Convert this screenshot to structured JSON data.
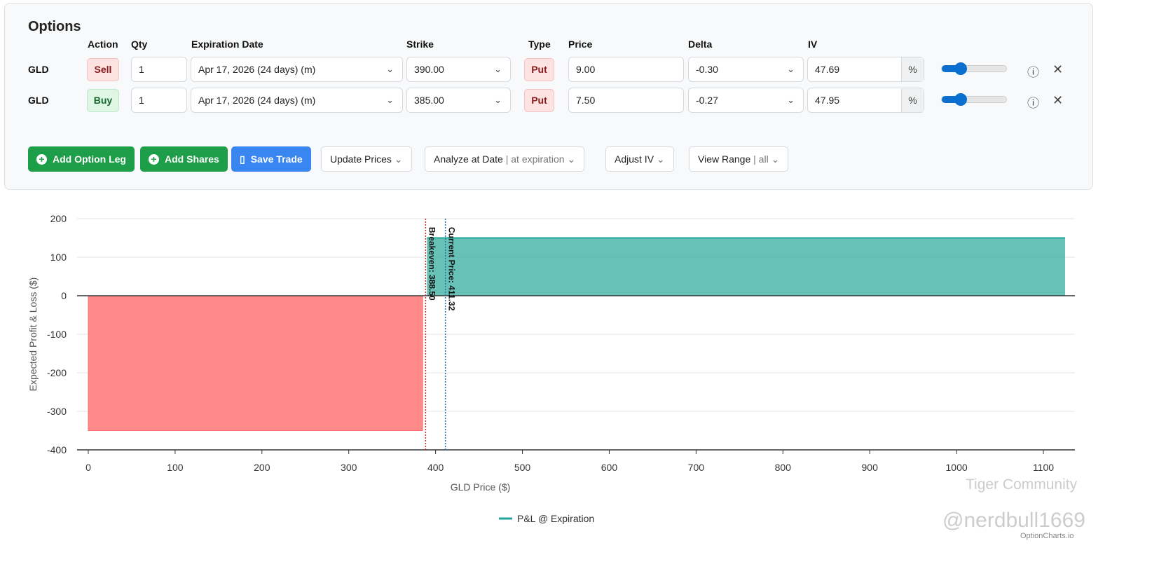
{
  "options": {
    "title": "Options",
    "headers": {
      "action": "Action",
      "qty": "Qty",
      "expiration": "Expiration Date",
      "strike": "Strike",
      "type": "Type",
      "price": "Price",
      "delta": "Delta",
      "iv": "IV"
    },
    "legs": [
      {
        "symbol": "GLD",
        "action": "Sell",
        "qty": "1",
        "expiration": "Apr 17, 2026 (24 days) (m)",
        "strike": "390.00",
        "type": "Put",
        "price": "9.00",
        "delta": "-0.30",
        "iv": "47.69",
        "iv_unit": "%"
      },
      {
        "symbol": "GLD",
        "action": "Buy",
        "qty": "1",
        "expiration": "Apr 17, 2026 (24 days) (m)",
        "strike": "385.00",
        "type": "Put",
        "price": "7.50",
        "delta": "-0.27",
        "iv": "47.95",
        "iv_unit": "%"
      }
    ],
    "buttons": {
      "add_leg": "Add Option Leg",
      "add_shares": "Add Shares",
      "save": "Save Trade",
      "update_prices": "Update Prices",
      "analyze": "Analyze at Date",
      "analyze_value": "| at expiration",
      "adjust_iv": "Adjust IV",
      "view_range": "View Range",
      "view_range_value": "| all"
    }
  },
  "watermark": {
    "brand": "Tiger Community",
    "user": "@nerdbull1669",
    "site": "OptionCharts.io"
  },
  "chart_data": {
    "type": "area",
    "xlabel": "GLD Price ($)",
    "ylabel": "Expected Profit & Loss ($)",
    "xlim": [
      0,
      1125
    ],
    "ylim": [
      -400,
      200
    ],
    "xticks": [
      0,
      100,
      200,
      300,
      400,
      500,
      600,
      700,
      800,
      900,
      1000,
      1100
    ],
    "yticks": [
      200,
      100,
      0,
      -100,
      -200,
      -300,
      -400
    ],
    "series": [
      {
        "name": "P&L @ Expiration",
        "x": [
          0,
          385,
          390,
          1125
        ],
        "y": [
          -350,
          -350,
          150,
          150
        ],
        "color": "#26a69a"
      }
    ],
    "loss_color": "#ff8a8a",
    "profit_color": "#4db6a9",
    "annotations": [
      {
        "label": "Breakeven: 388.50",
        "x": 388.5,
        "color": "#d62728"
      },
      {
        "label": "Current Price: 411.32",
        "x": 411.32,
        "color": "#1f77b4"
      }
    ],
    "legend": "bottom-center",
    "grid": true
  }
}
